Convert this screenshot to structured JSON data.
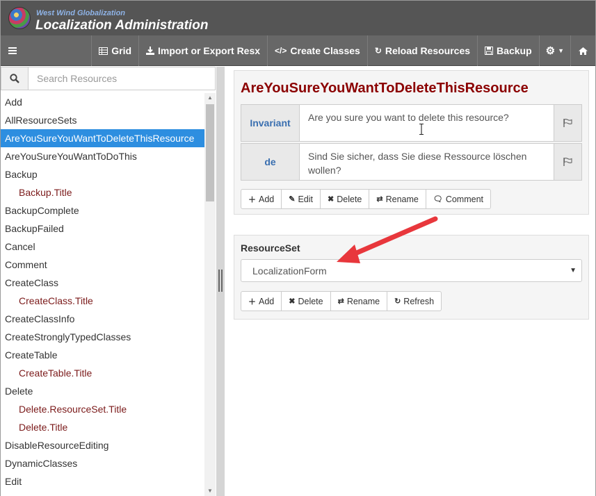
{
  "header": {
    "subtitle": "West Wind Globalization",
    "title": "Localization Administration",
    "logo_icon": "globe-logo"
  },
  "toolbar": {
    "items": [
      {
        "label": "Grid",
        "icon": "table-icon"
      },
      {
        "label": "Import or Export Resx",
        "icon": "download-icon"
      },
      {
        "label": "Create Classes",
        "icon": "code-icon"
      },
      {
        "label": "Reload Resources",
        "icon": "refresh-icon"
      },
      {
        "label": "Backup",
        "icon": "save-icon"
      }
    ]
  },
  "search": {
    "placeholder": "Search Resources"
  },
  "resources": [
    {
      "label": "Add"
    },
    {
      "label": "AllResourceSets"
    },
    {
      "label": "AreYouSureYouWantToDeleteThisResource",
      "selected": true
    },
    {
      "label": "AreYouSureYouWantToDoThis"
    },
    {
      "label": "Backup"
    },
    {
      "label": "Backup.Title",
      "child": true
    },
    {
      "label": "BackupComplete"
    },
    {
      "label": "BackupFailed"
    },
    {
      "label": "Cancel"
    },
    {
      "label": "Comment"
    },
    {
      "label": "CreateClass"
    },
    {
      "label": "CreateClass.Title",
      "child": true
    },
    {
      "label": "CreateClassInfo"
    },
    {
      "label": "CreateStronglyTypedClasses"
    },
    {
      "label": "CreateTable"
    },
    {
      "label": "CreateTable.Title",
      "child": true
    },
    {
      "label": "Delete"
    },
    {
      "label": "Delete.ResourceSet.Title",
      "child": true
    },
    {
      "label": "Delete.Title",
      "child": true
    },
    {
      "label": "DisableResourceEditing"
    },
    {
      "label": "DynamicClasses"
    },
    {
      "label": "Edit"
    }
  ],
  "resource_panel": {
    "title": "AreYouSureYouWantToDeleteThisResource",
    "translations": [
      {
        "lang": "Invariant",
        "text": "Are you sure you want to delete this resource?"
      },
      {
        "lang": "de",
        "text": "Sind Sie sicher, dass Sie diese Ressource löschen wollen?"
      }
    ],
    "buttons": {
      "add": "Add",
      "edit": "Edit",
      "delete": "Delete",
      "rename": "Rename",
      "comment": "Comment"
    }
  },
  "resourceset_panel": {
    "label": "ResourceSet",
    "selected": "LocalizationForm",
    "buttons": {
      "add": "Add",
      "delete": "Delete",
      "rename": "Rename",
      "refresh": "Refresh"
    }
  },
  "colors": {
    "header_bg": "#555555",
    "toolbar_bg": "#676767",
    "selected_bg": "#2d8ee0",
    "title_color": "#8b0000",
    "lang_color": "#3a6fb0",
    "arrow_color": "#e8373c"
  }
}
